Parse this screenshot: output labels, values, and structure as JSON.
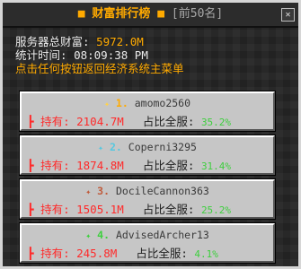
{
  "window": {
    "title_deco_left": "■",
    "title": "财富排行榜",
    "title_deco_right": "■",
    "subtitle": "[前50名]",
    "close_glyph": "✕"
  },
  "info": {
    "server_total_label": "服务器总财富: ",
    "server_total_value": "5972.0M",
    "stats_time_label": "统计时间: ",
    "stats_time_value": "08:09:38 PM",
    "back_hint": "点击任何按钮返回经济系统主菜单"
  },
  "rankings": [
    {
      "star": "✦",
      "rank": "1.",
      "player": "amomo2560",
      "rank_color": "#ffaa00",
      "star_color": "#ffd24a",
      "held_label": "持有: ",
      "held_value": "2104.7M",
      "share_label": "占比全服: ",
      "share_value": "35.2%"
    },
    {
      "star": "✦",
      "rank": "2.",
      "player": "Coperni3295",
      "rank_color": "#55c8e0",
      "star_color": "#55c8e0",
      "held_label": "持有: ",
      "held_value": "1874.8M",
      "share_label": "占比全服: ",
      "share_value": "31.4%"
    },
    {
      "star": "✦",
      "rank": "3.",
      "player": "DocileCannon363",
      "rank_color": "#c05a3a",
      "star_color": "#c05a3a",
      "held_label": "持有: ",
      "held_value": "1505.1M",
      "share_label": "占比全服: ",
      "share_value": "25.2%"
    },
    {
      "star": "✦",
      "rank": "4.",
      "player": "AdvisedArcher13",
      "rank_color": "#3ecf3e",
      "star_color": "#3ecf3e",
      "held_label": "持有: ",
      "held_value": "245.8M",
      "share_label": "占比全服: ",
      "share_value": "4.1%"
    }
  ]
}
